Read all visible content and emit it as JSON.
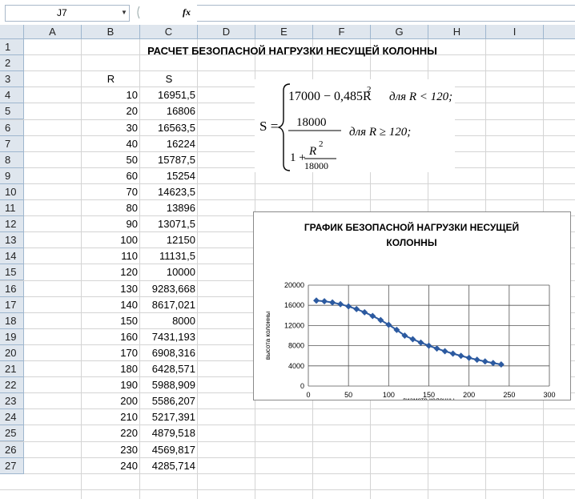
{
  "namebox": {
    "value": "J7"
  },
  "formula_bar": {
    "fx": "fx",
    "content": ""
  },
  "columns": [
    "A",
    "B",
    "C",
    "D",
    "E",
    "F",
    "G",
    "H",
    "I"
  ],
  "rows": [
    "1",
    "2",
    "3",
    "4",
    "5",
    "6",
    "7",
    "8",
    "9",
    "10",
    "11",
    "12",
    "13",
    "14",
    "15",
    "16",
    "17",
    "18",
    "19",
    "20",
    "21",
    "22",
    "23",
    "24",
    "25",
    "26",
    "27"
  ],
  "sheet_title": "РАСЧЕТ БЕЗОПАСНОЙ НАГРУЗКИ НЕСУЩЕЙ КОЛОННЫ",
  "headers": {
    "r": "R",
    "s": "S"
  },
  "table": {
    "R": [
      "10",
      "20",
      "30",
      "40",
      "50",
      "60",
      "70",
      "80",
      "90",
      "100",
      "110",
      "120",
      "130",
      "140",
      "150",
      "160",
      "170",
      "180",
      "190",
      "200",
      "210",
      "220",
      "230",
      "240"
    ],
    "S": [
      "16951,5",
      "16806",
      "16563,5",
      "16224",
      "15787,5",
      "15254",
      "14623,5",
      "13896",
      "13071,5",
      "12150",
      "11131,5",
      "10000",
      "9283,668",
      "8617,021",
      "8000",
      "7431,193",
      "6908,316",
      "6428,571",
      "5988,909",
      "5586,207",
      "5217,391",
      "4879,518",
      "4569,817",
      "4285,714"
    ]
  },
  "formula": {
    "lhs": "S =",
    "line1": "17000 − 0,485R",
    "exp1": "2",
    "cond1": "для R < 120;",
    "num": "18000",
    "den_one": "1 +",
    "den_r": "R",
    "den_exp": "2",
    "den_den": "18000",
    "cond2": "для R ≥ 120;"
  },
  "chart_data": {
    "type": "line",
    "title_line1": "ГРАФИК БЕЗОПАСНОЙ НАГРУЗКИ НЕСУЩЕЙ",
    "title_line2": "КОЛОННЫ",
    "xlabel": "диаметр колонны",
    "ylabel": "высота колонны",
    "xlim": [
      0,
      300
    ],
    "ylim": [
      0,
      20000
    ],
    "xticks": [
      "0",
      "50",
      "100",
      "150",
      "200",
      "250",
      "300"
    ],
    "yticks": [
      "0",
      "4000",
      "8000",
      "12000",
      "16000",
      "20000"
    ],
    "grid": true,
    "legend": "none",
    "color": "#2c5aa0",
    "x": [
      10,
      20,
      30,
      40,
      50,
      60,
      70,
      80,
      90,
      100,
      110,
      120,
      130,
      140,
      150,
      160,
      170,
      180,
      190,
      200,
      210,
      220,
      230,
      240
    ],
    "y": [
      16951.5,
      16806,
      16563.5,
      16224,
      15787.5,
      15254,
      14623.5,
      13896,
      13071.5,
      12150,
      11131.5,
      10000,
      9283.668,
      8617.021,
      8000,
      7431.193,
      6908.316,
      6428.571,
      5988.909,
      5586.207,
      5217.391,
      4879.518,
      4569.817,
      4285.714
    ]
  }
}
